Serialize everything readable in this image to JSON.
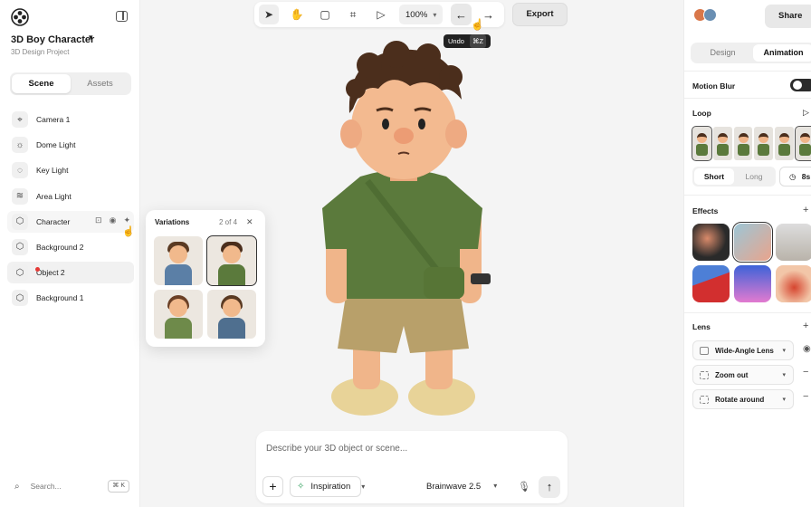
{
  "project": {
    "title": "3D Boy Character",
    "subtitle": "3D Design Project"
  },
  "left_tabs": {
    "scene": "Scene",
    "assets": "Assets"
  },
  "layers": [
    {
      "label": "Camera 1",
      "icon": "camera-focus-icon"
    },
    {
      "label": "Dome Light",
      "icon": "sun-icon"
    },
    {
      "label": "Key Light",
      "icon": "lightbulb-icon"
    },
    {
      "label": "Area Light",
      "icon": "area-light-icon"
    },
    {
      "label": "Character",
      "icon": "cube-icon"
    },
    {
      "label": "Background 2",
      "icon": "cube-icon"
    },
    {
      "label": "Object 2",
      "icon": "cube-icon"
    },
    {
      "label": "Background 1",
      "icon": "cube-icon"
    }
  ],
  "search": {
    "label": "Search...",
    "shortcut": "⌘ K"
  },
  "variations": {
    "title": "Variations",
    "count": "2 of 4"
  },
  "toolbar": {
    "zoom": "100%",
    "export": "Export",
    "tooltip_label": "Undo",
    "tooltip_key": "⌘Z"
  },
  "prompt": {
    "placeholder": "Describe your 3D object or scene...",
    "inspiration": "Inspiration",
    "model": "Brainwave 2.5"
  },
  "right": {
    "share": "Share",
    "tab_design": "Design",
    "tab_animation": "Animation",
    "motion_blur": "Motion Blur",
    "motion_blur_on": true,
    "loop": "Loop",
    "short": "Short",
    "long": "Long",
    "duration": "8s",
    "effects": "Effects",
    "lens": "Lens",
    "lens_items": [
      "Wide-Angle Lens",
      "Zoom out",
      "Rotate around"
    ]
  },
  "colors": {
    "accent_dark": "#2b2b2b",
    "shirt": "#5b7a3c",
    "shorts": "#b8a06a",
    "inspiration_icon": "#2e9e5b"
  }
}
